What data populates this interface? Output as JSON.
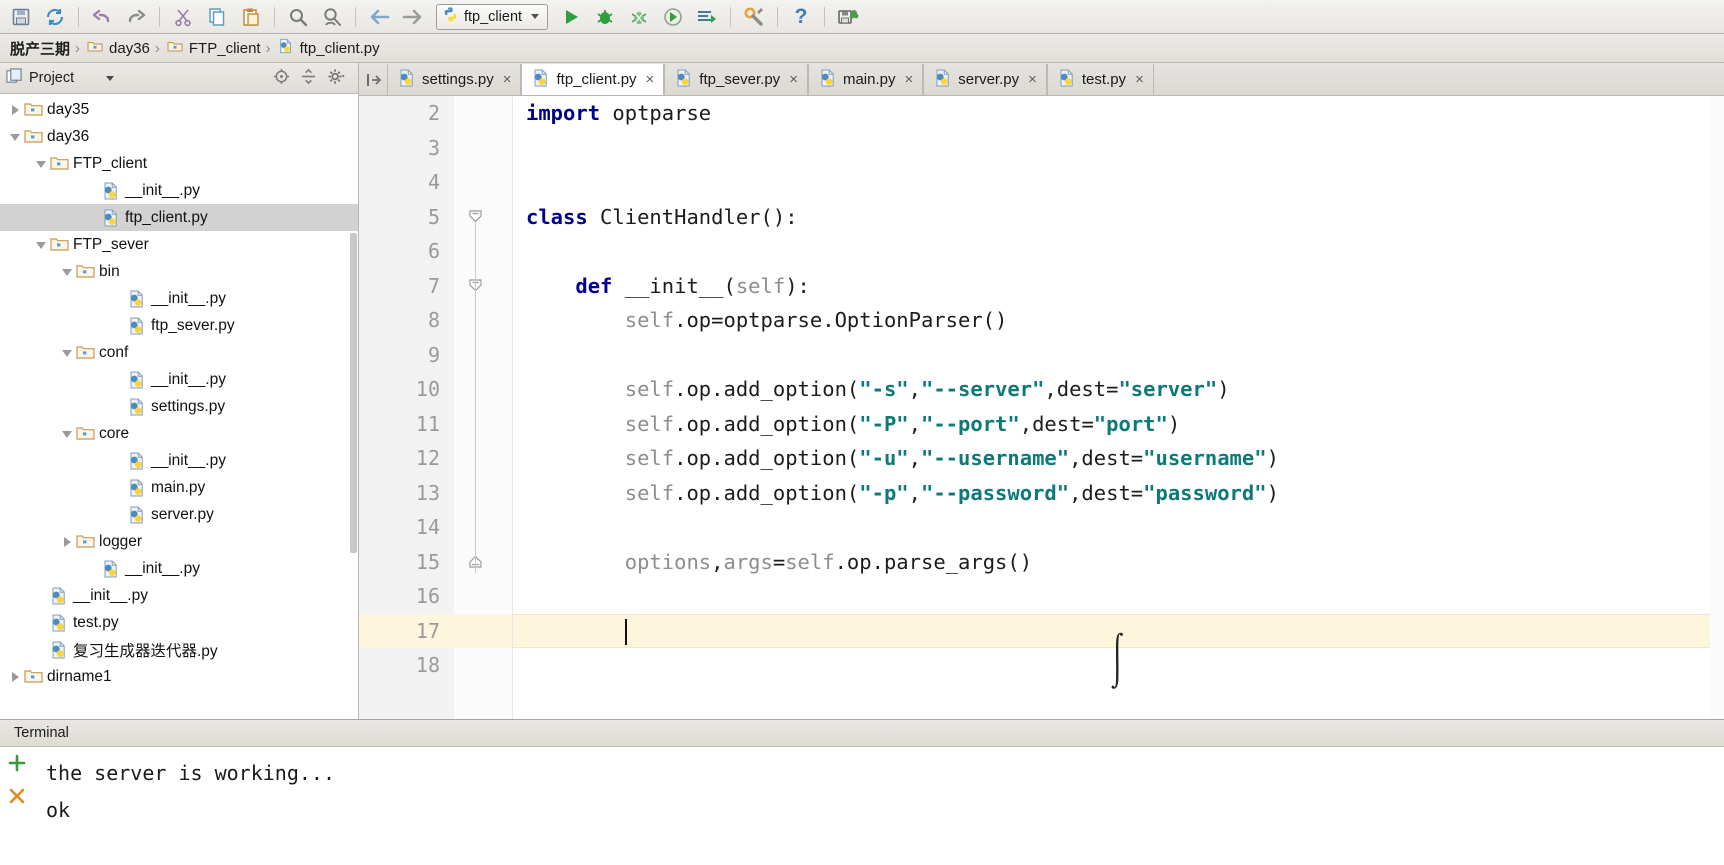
{
  "toolbar": {
    "icons": [
      {
        "name": "save-icon",
        "glyph": "save"
      },
      {
        "name": "sync-refresh-icon",
        "glyph": "sync"
      },
      {
        "name": "undo-icon",
        "glyph": "undo"
      },
      {
        "name": "redo-icon",
        "glyph": "redo"
      },
      {
        "name": "cut-icon",
        "glyph": "cut"
      },
      {
        "name": "copy-icon",
        "glyph": "copy"
      },
      {
        "name": "paste-icon",
        "glyph": "paste"
      },
      {
        "name": "find-icon",
        "glyph": "find"
      },
      {
        "name": "replace-icon",
        "glyph": "replace"
      },
      {
        "name": "back-icon",
        "glyph": "back"
      },
      {
        "name": "forward-icon",
        "glyph": "forward"
      }
    ],
    "run_config_label": "ftp_client",
    "run_icons": [
      {
        "name": "run-icon",
        "glyph": "run"
      },
      {
        "name": "debug-icon",
        "glyph": "debug"
      },
      {
        "name": "coverage-icon",
        "glyph": "coverage"
      },
      {
        "name": "profile-icon",
        "glyph": "profile"
      },
      {
        "name": "run-with-console-icon",
        "glyph": "console"
      }
    ],
    "settings_icon": "wrench-icon",
    "help_icon": "help-icon",
    "help_label": "?",
    "vcs_icon": "save-all-icon"
  },
  "breadcrumb": {
    "items": [
      {
        "label": "脱产三期",
        "icon": "none"
      },
      {
        "label": "day36",
        "icon": "folder-icon"
      },
      {
        "label": "FTP_client",
        "icon": "folder-icon"
      },
      {
        "label": "ftp_client.py",
        "icon": "python-file-icon"
      }
    ],
    "separator": "›"
  },
  "project_panel": {
    "header": {
      "title": "Project",
      "panel_icon": "project-view-icon",
      "dropdown_icon": "chevron-down-icon",
      "locate_icon": "scroll-from-source-icon",
      "collapse_icon": "collapse-all-icon",
      "settings_icon": "gear-icon"
    },
    "tree": [
      {
        "label": "day35",
        "indent": 1,
        "state": "closed",
        "icon": "folder-icon",
        "selected": false
      },
      {
        "label": "day36",
        "indent": 1,
        "state": "open",
        "icon": "folder-icon",
        "selected": false
      },
      {
        "label": "FTP_client",
        "indent": 2,
        "state": "open",
        "icon": "folder-icon",
        "selected": false
      },
      {
        "label": "__init__.py",
        "indent": 4,
        "state": "none",
        "icon": "python-file-icon",
        "selected": false
      },
      {
        "label": "ftp_client.py",
        "indent": 4,
        "state": "none",
        "icon": "python-file-icon",
        "selected": true
      },
      {
        "label": "FTP_sever",
        "indent": 2,
        "state": "open",
        "icon": "folder-icon",
        "selected": false
      },
      {
        "label": "bin",
        "indent": 3,
        "state": "open",
        "icon": "folder-icon",
        "selected": false
      },
      {
        "label": "__init__.py",
        "indent": 5,
        "state": "none",
        "icon": "python-file-icon",
        "selected": false
      },
      {
        "label": "ftp_sever.py",
        "indent": 5,
        "state": "none",
        "icon": "python-file-icon",
        "selected": false
      },
      {
        "label": "conf",
        "indent": 3,
        "state": "open",
        "icon": "folder-icon",
        "selected": false
      },
      {
        "label": "__init__.py",
        "indent": 5,
        "state": "none",
        "icon": "python-file-icon",
        "selected": false
      },
      {
        "label": "settings.py",
        "indent": 5,
        "state": "none",
        "icon": "python-file-icon",
        "selected": false
      },
      {
        "label": "core",
        "indent": 3,
        "state": "open",
        "icon": "folder-icon",
        "selected": false
      },
      {
        "label": "__init__.py",
        "indent": 5,
        "state": "none",
        "icon": "python-file-icon",
        "selected": false
      },
      {
        "label": "main.py",
        "indent": 5,
        "state": "none",
        "icon": "python-file-icon",
        "selected": false
      },
      {
        "label": "server.py",
        "indent": 5,
        "state": "none",
        "icon": "python-file-icon",
        "selected": false
      },
      {
        "label": "logger",
        "indent": 3,
        "state": "closed",
        "icon": "folder-icon",
        "selected": false
      },
      {
        "label": "__init__.py",
        "indent": 4,
        "state": "none",
        "icon": "python-file-icon",
        "selected": false
      },
      {
        "label": "__init__.py",
        "indent": 2,
        "state": "none",
        "icon": "python-file-icon",
        "selected": false
      },
      {
        "label": "test.py",
        "indent": 2,
        "state": "none",
        "icon": "python-file-icon",
        "selected": false
      },
      {
        "label": "复习生成器迭代器.py",
        "indent": 2,
        "state": "none",
        "icon": "python-file-icon",
        "selected": false
      },
      {
        "label": "dirname1",
        "indent": 1,
        "state": "closed",
        "icon": "folder-icon",
        "selected": false
      }
    ]
  },
  "editor": {
    "pin_icon": "show-tabs-icon",
    "tabs": [
      {
        "label": "settings.py",
        "active": false,
        "icon": "python-file-icon",
        "close": "×"
      },
      {
        "label": "ftp_client.py",
        "active": true,
        "icon": "python-file-icon",
        "close": "×"
      },
      {
        "label": "ftp_sever.py",
        "active": false,
        "icon": "python-file-icon",
        "close": "×"
      },
      {
        "label": "main.py",
        "active": false,
        "icon": "python-file-icon",
        "close": "×"
      },
      {
        "label": "server.py",
        "active": false,
        "icon": "python-file-icon",
        "close": "×"
      },
      {
        "label": "test.py",
        "active": false,
        "icon": "python-file-icon",
        "close": "×"
      }
    ],
    "first_visible_line": 2,
    "cursor_line": 17,
    "lines": [
      {
        "num": "2",
        "tokens": [
          {
            "t": "import",
            "c": "kw"
          },
          {
            "t": " optparse",
            "c": "fn"
          }
        ]
      },
      {
        "num": "3",
        "tokens": []
      },
      {
        "num": "4",
        "tokens": []
      },
      {
        "num": "5",
        "tokens": [
          {
            "t": "class",
            "c": "kw"
          },
          {
            "t": " ClientHandler():",
            "c": "cls-name"
          }
        ]
      },
      {
        "num": "6",
        "tokens": []
      },
      {
        "num": "7",
        "tokens": [
          {
            "t": "    ",
            "c": "fn"
          },
          {
            "t": "def",
            "c": "kw"
          },
          {
            "t": " __init__",
            "c": "dunder"
          },
          {
            "t": "(",
            "c": "fn"
          },
          {
            "t": "self",
            "c": "slf"
          },
          {
            "t": "):",
            "c": "fn"
          }
        ]
      },
      {
        "num": "8",
        "tokens": [
          {
            "t": "        ",
            "c": "fn"
          },
          {
            "t": "self",
            "c": "slf"
          },
          {
            "t": ".op=optparse.OptionParser()",
            "c": "fn"
          }
        ]
      },
      {
        "num": "9",
        "tokens": []
      },
      {
        "num": "10",
        "tokens": [
          {
            "t": "        ",
            "c": "fn"
          },
          {
            "t": "self",
            "c": "slf"
          },
          {
            "t": ".op.add_option(",
            "c": "fn"
          },
          {
            "t": "\"-s\"",
            "c": "str"
          },
          {
            "t": ",",
            "c": "fn"
          },
          {
            "t": "\"--server\"",
            "c": "str"
          },
          {
            "t": ",dest=",
            "c": "fn"
          },
          {
            "t": "\"server\"",
            "c": "str"
          },
          {
            "t": ")",
            "c": "fn"
          }
        ]
      },
      {
        "num": "11",
        "tokens": [
          {
            "t": "        ",
            "c": "fn"
          },
          {
            "t": "self",
            "c": "slf"
          },
          {
            "t": ".op.add_option(",
            "c": "fn"
          },
          {
            "t": "\"-P\"",
            "c": "str"
          },
          {
            "t": ",",
            "c": "fn"
          },
          {
            "t": "\"--port\"",
            "c": "str"
          },
          {
            "t": ",dest=",
            "c": "fn"
          },
          {
            "t": "\"port\"",
            "c": "str"
          },
          {
            "t": ")",
            "c": "fn"
          }
        ]
      },
      {
        "num": "12",
        "tokens": [
          {
            "t": "        ",
            "c": "fn"
          },
          {
            "t": "self",
            "c": "slf"
          },
          {
            "t": ".op.add_option(",
            "c": "fn"
          },
          {
            "t": "\"-u\"",
            "c": "str"
          },
          {
            "t": ",",
            "c": "fn"
          },
          {
            "t": "\"--username\"",
            "c": "str"
          },
          {
            "t": ",dest=",
            "c": "fn"
          },
          {
            "t": "\"username\"",
            "c": "str"
          },
          {
            "t": ")",
            "c": "fn"
          }
        ]
      },
      {
        "num": "13",
        "tokens": [
          {
            "t": "        ",
            "c": "fn"
          },
          {
            "t": "self",
            "c": "slf"
          },
          {
            "t": ".op.add_option(",
            "c": "fn"
          },
          {
            "t": "\"-p\"",
            "c": "str"
          },
          {
            "t": ",",
            "c": "fn"
          },
          {
            "t": "\"--password\"",
            "c": "str"
          },
          {
            "t": ",dest=",
            "c": "fn"
          },
          {
            "t": "\"password\"",
            "c": "str"
          },
          {
            "t": ")",
            "c": "fn"
          }
        ]
      },
      {
        "num": "14",
        "tokens": []
      },
      {
        "num": "15",
        "tokens": [
          {
            "t": "        ",
            "c": "fn"
          },
          {
            "t": "options",
            "c": "slf"
          },
          {
            "t": ",",
            "c": "fn"
          },
          {
            "t": "args",
            "c": "slf"
          },
          {
            "t": "=",
            "c": "fn"
          },
          {
            "t": "self",
            "c": "slf"
          },
          {
            "t": ".op.parse_args()",
            "c": "fn"
          }
        ]
      },
      {
        "num": "16",
        "tokens": []
      },
      {
        "num": "17",
        "tokens": [],
        "cursor": true
      },
      {
        "num": "18",
        "tokens": []
      }
    ]
  },
  "terminal": {
    "tab_label": "Terminal",
    "new_session_icon": "plus-icon",
    "close_session_icon": "close-x-icon",
    "new_session_color": "#3c9a3c",
    "close_session_color": "#e08a20",
    "output": [
      "the server is working...",
      "ok"
    ]
  },
  "colors": {
    "keyword": "#00008f",
    "string": "#0b7a78",
    "selection": "#d2d2d2",
    "current_line": "#fdf6dd",
    "gutter_bg": "#f2f2f2"
  }
}
